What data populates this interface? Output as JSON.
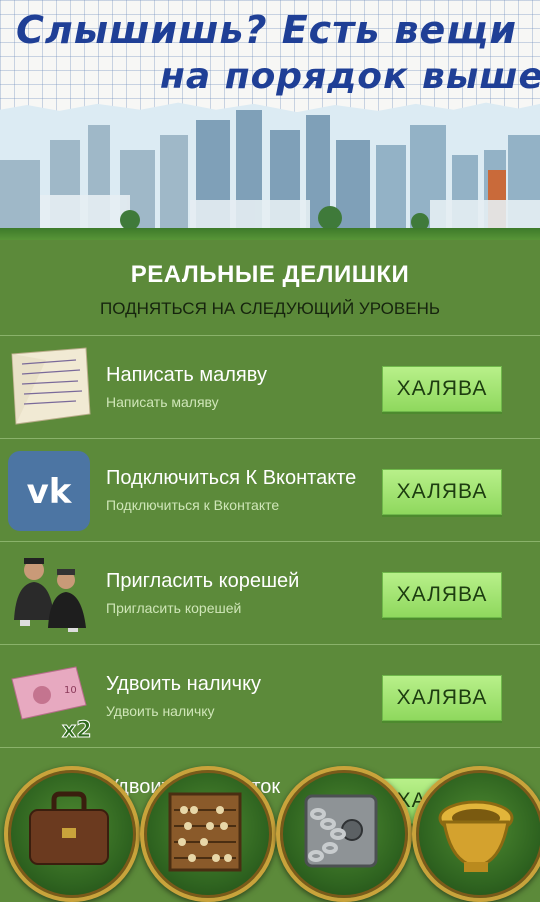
{
  "banner": {
    "title_line1": "Слышишь? Есть вещи",
    "title_line2": "на порядок выше!"
  },
  "panel": {
    "heading": "РЕАЛЬНЫЕ ДЕЛИШКИ",
    "subheading": "ПОДНЯТЬСЯ НА СЛЕДУЮЩИЙ УРОВЕНЬ"
  },
  "offers": [
    {
      "icon": "letter-icon",
      "title": "Написать маляву",
      "subtitle": "Написать маляву",
      "button": "ХАЛЯВА"
    },
    {
      "icon": "vk-icon",
      "title": "Подключиться К Вконтакте",
      "subtitle": "Подключиться к Вконтакте",
      "button": "ХАЛЯВА"
    },
    {
      "icon": "friends-icon",
      "title": "Пригласить корешей",
      "subtitle": "Пригласить корешей",
      "button": "ХАЛЯВА"
    },
    {
      "icon": "banknote-x2-icon",
      "badge": "x2",
      "title": "Удвоить наличку",
      "subtitle": "Удвоить наличку",
      "button": "ХАЛЯВА"
    },
    {
      "icon": "partial-icon",
      "title": "Удвоить заработок",
      "button": "ХАЛЯВА"
    }
  ],
  "dock": [
    {
      "icon": "briefcase-icon"
    },
    {
      "icon": "abacus-icon"
    },
    {
      "icon": "chained-safe-icon"
    },
    {
      "icon": "golden-toilet-icon"
    }
  ],
  "colors": {
    "background": "#5c8a3a",
    "button": "#9fe070",
    "title_ink": "#1f3f96"
  }
}
